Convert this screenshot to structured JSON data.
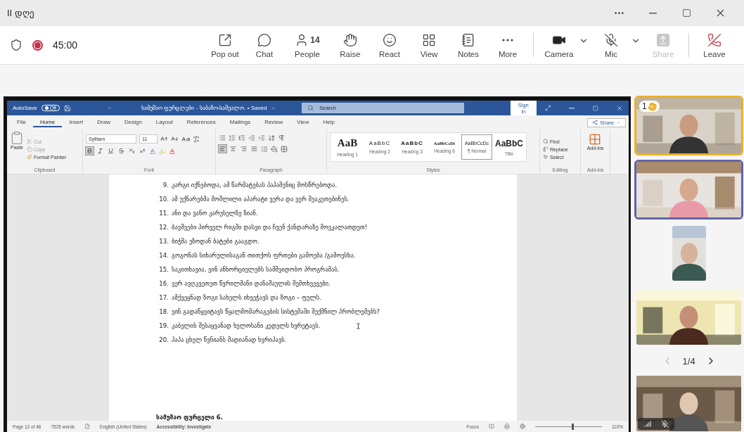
{
  "window": {
    "title": "II დღე"
  },
  "meeting_bar": {
    "recording": true,
    "timer": "45:00",
    "actions": [
      {
        "kind": "popout",
        "label": "Pop out",
        "disabled": false
      },
      {
        "kind": "chat",
        "label": "Chat",
        "disabled": false
      },
      {
        "kind": "people",
        "label": "People",
        "count": "14",
        "disabled": false
      },
      {
        "kind": "raise",
        "label": "Raise",
        "disabled": false
      },
      {
        "kind": "react",
        "label": "React",
        "disabled": false
      },
      {
        "kind": "view",
        "label": "View",
        "disabled": false
      },
      {
        "kind": "notes",
        "label": "Notes",
        "disabled": false
      },
      {
        "kind": "more",
        "label": "More",
        "disabled": false
      }
    ],
    "devices": [
      {
        "kind": "camera",
        "label": "Camera",
        "off": false,
        "disabled": false
      },
      {
        "kind": "mic",
        "label": "Mic",
        "off": true,
        "disabled": false
      },
      {
        "kind": "share",
        "label": "Share",
        "disabled": true
      }
    ],
    "leave": "Leave"
  },
  "word": {
    "autosave_label": "AutoSave",
    "autosave_on": false,
    "autosave_state": "Off",
    "title": "სამუშაო ფურცლები - საბაზო-საშუალო. • Saved",
    "search_placeholder": "Search",
    "sign_in": "Sign in",
    "share": "Share",
    "tabs": [
      {
        "label": "File",
        "selected": false
      },
      {
        "label": "Home",
        "selected": true
      },
      {
        "label": "Insert",
        "selected": false
      },
      {
        "label": "Draw",
        "selected": false
      },
      {
        "label": "Design",
        "selected": false
      },
      {
        "label": "Layout",
        "selected": false
      },
      {
        "label": "References",
        "selected": false
      },
      {
        "label": "Mailings",
        "selected": false
      },
      {
        "label": "Review",
        "selected": false
      },
      {
        "label": "View",
        "selected": false
      },
      {
        "label": "Help",
        "selected": false
      }
    ],
    "clipboard": {
      "paste": "Paste",
      "cut": "Cut",
      "copy": "Copy",
      "format_painter": "Format Painter",
      "label": "Clipboard"
    },
    "font": {
      "name": "Sylfaen",
      "size": "11",
      "label": "Font",
      "format": [
        {
          "kind": "bold",
          "on": true
        },
        {
          "kind": "italic",
          "on": false
        },
        {
          "kind": "underline",
          "on": false
        },
        {
          "kind": "strike",
          "on": false
        },
        {
          "kind": "subscript",
          "on": false
        },
        {
          "kind": "superscript",
          "on": false
        }
      ]
    },
    "paragraph": {
      "label": "Paragraph",
      "align": [
        {
          "kind": "left",
          "selected": true
        },
        {
          "kind": "center",
          "selected": false
        },
        {
          "kind": "right",
          "selected": false
        },
        {
          "kind": "justify",
          "selected": false
        }
      ]
    },
    "styles": {
      "label": "Styles",
      "items": [
        {
          "preview": "AaB",
          "name": "Heading 1",
          "kind": "h1",
          "selected": false
        },
        {
          "preview": "AaBbC",
          "name": "Heading 2",
          "kind": "h2",
          "selected": false
        },
        {
          "preview": "AaBbC",
          "name": "Heading 3",
          "kind": "h3",
          "selected": false
        },
        {
          "preview": "AaBbCcDt",
          "name": "Heading 6",
          "kind": "h6",
          "selected": false
        },
        {
          "preview": "AaBbCcDc",
          "name": "¶ Normal",
          "kind": "normal",
          "selected": true
        },
        {
          "preview": "AaBbC",
          "name": "Title",
          "kind": "title",
          "selected": false
        }
      ]
    },
    "editing": {
      "find": "Find",
      "replace": "Replace",
      "select": "Select",
      "label": "Editing"
    },
    "addins": {
      "button": "Add-ins",
      "label": "Add-ins"
    },
    "document": {
      "lines": [
        {
          "number": "9.",
          "text": "კარგი იქნებოდა, ამ წარმატებას პაპაშენიც მოსწრებოდა."
        },
        {
          "number": "10.",
          "text": "ამ უქნარებმა მოშლილი აპარატი ვერა და ვერ შეაკეთებინეს."
        },
        {
          "number": "11.",
          "text": "ანი და ვანო კარუსელზე ზიან."
        },
        {
          "number": "12.",
          "text": "ბავშვები პირველ რიგში დასვი და ჩვენ ქანდარაზე მოვკალათდეთ!"
        },
        {
          "number": "13.",
          "text": "ბიჭმა ეზოდან ბატები გააგდო."
        },
        {
          "number": "14.",
          "text": "გოგონას სიხარულისაგან თითქოს ფრთები გამოება /გამოესხა."
        },
        {
          "number": "15.",
          "text": "საკითხავია, ვინ ანხორციელებს სამშვიდობო პროგრამას."
        },
        {
          "number": "16.",
          "text": "ვერ ავღკვეთეთ წვრილმანი დანაშაულის შემთხვევები."
        },
        {
          "number": "17.",
          "text": "ამქვეყნად ზოგი სახელს იხვეჭავს და ზოგი – ფულს."
        },
        {
          "number": "18.",
          "text": "ვინ გადაწყვიტავს წყალმომარაგების სისტემაში შექმნილ პრობლემებს?"
        },
        {
          "number": "19.",
          "text": "კაბელის შესაყვანად ხელოსანი კედელს ხვრეტავს."
        },
        {
          "number": "20.",
          "text": "პაპა ცხელ წვნიანს მადიანად ხვრიპავს."
        }
      ],
      "next_heading": "სამუშაო ფურცელი 6."
    },
    "status": {
      "page": "Page 12 of 46",
      "words": "7525 words",
      "language": "English (United States)",
      "accessibility": "Accessibility: Investigate",
      "focus": "Focus",
      "zoom": "110%",
      "zoom_level": {
        "level": 0.55
      }
    }
  },
  "participants": {
    "tiles": [
      {
        "hand": "1",
        "speaking": false,
        "muted": false
      },
      {
        "speaking": true,
        "muted": false
      },
      {
        "speaking": false,
        "muted": false
      },
      {
        "speaking": false,
        "muted": false
      }
    ],
    "pager": "1/4",
    "bottom_tile": {
      "speaking": false,
      "muted": true
    }
  }
}
